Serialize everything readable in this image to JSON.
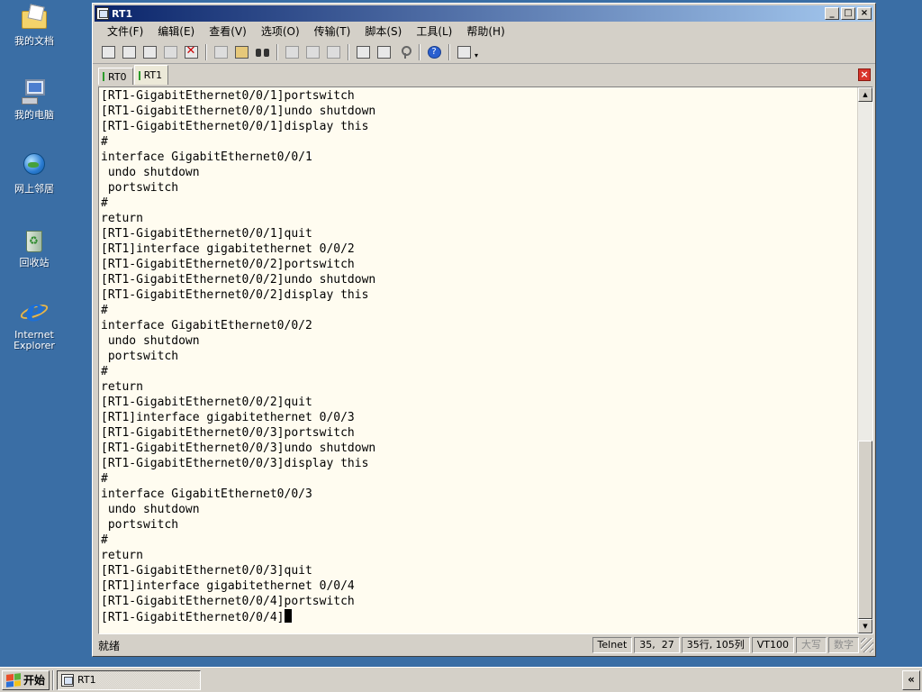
{
  "desktop": {
    "icons": [
      {
        "label": "我的文档"
      },
      {
        "label": "我的电脑"
      },
      {
        "label": "网上邻居"
      },
      {
        "label": "回收站"
      },
      {
        "label_line1": "Internet",
        "label_line2": "Explorer"
      }
    ]
  },
  "window": {
    "title": "RT1",
    "controls": {
      "minimize": "_",
      "maximize": "□",
      "close": "×"
    }
  },
  "menu": {
    "items": [
      "文件(F)",
      "编辑(E)",
      "查看(V)",
      "选项(O)",
      "传输(T)",
      "脚本(S)",
      "工具(L)",
      "帮助(H)"
    ]
  },
  "toolbar": {
    "icons": [
      "connect-icon",
      "quick-connect-icon",
      "connect-in-tab-icon",
      "reconnect-icon",
      "disconnect-icon",
      "copy-icon",
      "paste-icon",
      "find-icon",
      "print-icon",
      "print-setup-icon",
      "print-preview-icon",
      "session-options-icon",
      "keymap-icon",
      "key-icon",
      "help-icon",
      "sftp-icon"
    ],
    "dropdown_glyph": "▾"
  },
  "tabs": [
    {
      "label": "RT0",
      "active": false
    },
    {
      "label": "RT1",
      "active": true
    }
  ],
  "tab_close_glyph": "×",
  "terminal": {
    "lines": [
      "[RT1-GigabitEthernet0/0/1]portswitch",
      "[RT1-GigabitEthernet0/0/1]undo shutdown",
      "[RT1-GigabitEthernet0/0/1]display this",
      "#",
      "interface GigabitEthernet0/0/1",
      " undo shutdown",
      " portswitch",
      "#",
      "return",
      "[RT1-GigabitEthernet0/0/1]quit",
      "[RT1]interface gigabitethernet 0/0/2",
      "[RT1-GigabitEthernet0/0/2]portswitch",
      "[RT1-GigabitEthernet0/0/2]undo shutdown",
      "[RT1-GigabitEthernet0/0/2]display this",
      "#",
      "interface GigabitEthernet0/0/2",
      " undo shutdown",
      " portswitch",
      "#",
      "return",
      "[RT1-GigabitEthernet0/0/2]quit",
      "[RT1]interface gigabitethernet 0/0/3",
      "[RT1-GigabitEthernet0/0/3]portswitch",
      "[RT1-GigabitEthernet0/0/3]undo shutdown",
      "[RT1-GigabitEthernet0/0/3]display this",
      "#",
      "interface GigabitEthernet0/0/3",
      " undo shutdown",
      " portswitch",
      "#",
      "return",
      "[RT1-GigabitEthernet0/0/3]quit",
      "[RT1]interface gigabitethernet 0/0/4",
      "[RT1-GigabitEthernet0/0/4]portswitch",
      "[RT1-GigabitEthernet0/0/4]"
    ],
    "scroll_up_glyph": "▲",
    "scroll_down_glyph": "▼"
  },
  "status": {
    "text": "就绪",
    "protocol": "Telnet",
    "cursor_pos": "35,  27",
    "size": "35行, 105列",
    "term_type": "VT100",
    "caps": "大写",
    "numlock": "数字"
  },
  "taskbar": {
    "start_label": "开始",
    "task_label": "RT1",
    "chevron": "«"
  },
  "colors": {
    "desktop": "#3a6ea5",
    "terminal_bg": "#fffcf0",
    "titlebar_start": "#0a246a",
    "titlebar_end": "#a6caf0"
  }
}
